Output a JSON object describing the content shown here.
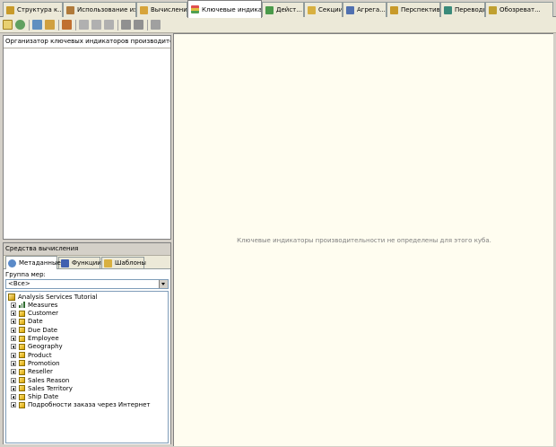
{
  "tabs": [
    {
      "label": "Структура к...",
      "icon": "cube-structure-icon",
      "color": "#c89a2a"
    },
    {
      "label": "Использование из...",
      "icon": "dimension-usage-icon",
      "color": "#b07a3a"
    },
    {
      "label": "Вычисления",
      "icon": "calculations-icon",
      "color": "#d7a43a"
    },
    {
      "label": "Ключевые индика...",
      "icon": "kpi-icon",
      "color": "#5a7ec8"
    },
    {
      "label": "Дейст...",
      "icon": "actions-icon",
      "color": "#4a9a4a"
    },
    {
      "label": "Секции",
      "icon": "partitions-icon",
      "color": "#d8b040"
    },
    {
      "label": "Агрега...",
      "icon": "aggregations-icon",
      "color": "#5070b0"
    },
    {
      "label": "Перспективы",
      "icon": "perspectives-icon",
      "color": "#c89a2a"
    },
    {
      "label": "Переводы",
      "icon": "translations-icon",
      "color": "#3a8a7a"
    },
    {
      "label": "Обозреват...",
      "icon": "browser-icon",
      "color": "#c0a030"
    }
  ],
  "organizer": {
    "title": "Организатор ключевых индикаторов производительности"
  },
  "tools": {
    "title": "Средства вычисления",
    "subtabs": [
      {
        "label": "Метаданные",
        "icon": "metadata-icon"
      },
      {
        "label": "Функции",
        "icon": "functions-icon"
      },
      {
        "label": "Шаблоны",
        "icon": "templates-icon"
      }
    ],
    "group_label": "Группа мер:",
    "group_value": "<Все>",
    "tree_root": "Analysis Services Tutorial",
    "tree_items": [
      {
        "label": "Measures",
        "icon": "measures-icon"
      },
      {
        "label": "Customer",
        "icon": "dimension-icon"
      },
      {
        "label": "Date",
        "icon": "dimension-icon"
      },
      {
        "label": "Due Date",
        "icon": "dimension-icon"
      },
      {
        "label": "Employee",
        "icon": "dimension-icon"
      },
      {
        "label": "Geography",
        "icon": "dimension-icon"
      },
      {
        "label": "Product",
        "icon": "dimension-icon"
      },
      {
        "label": "Promotion",
        "icon": "dimension-icon"
      },
      {
        "label": "Reseller",
        "icon": "dimension-icon"
      },
      {
        "label": "Sales Reason",
        "icon": "dimension-icon"
      },
      {
        "label": "Sales Territory",
        "icon": "dimension-icon"
      },
      {
        "label": "Ship Date",
        "icon": "dimension-icon"
      },
      {
        "label": "Подробности заказа через Интернет",
        "icon": "dimension-icon"
      }
    ]
  },
  "main": {
    "message": "Ключевые индикаторы производительности не определены для этого куба."
  }
}
